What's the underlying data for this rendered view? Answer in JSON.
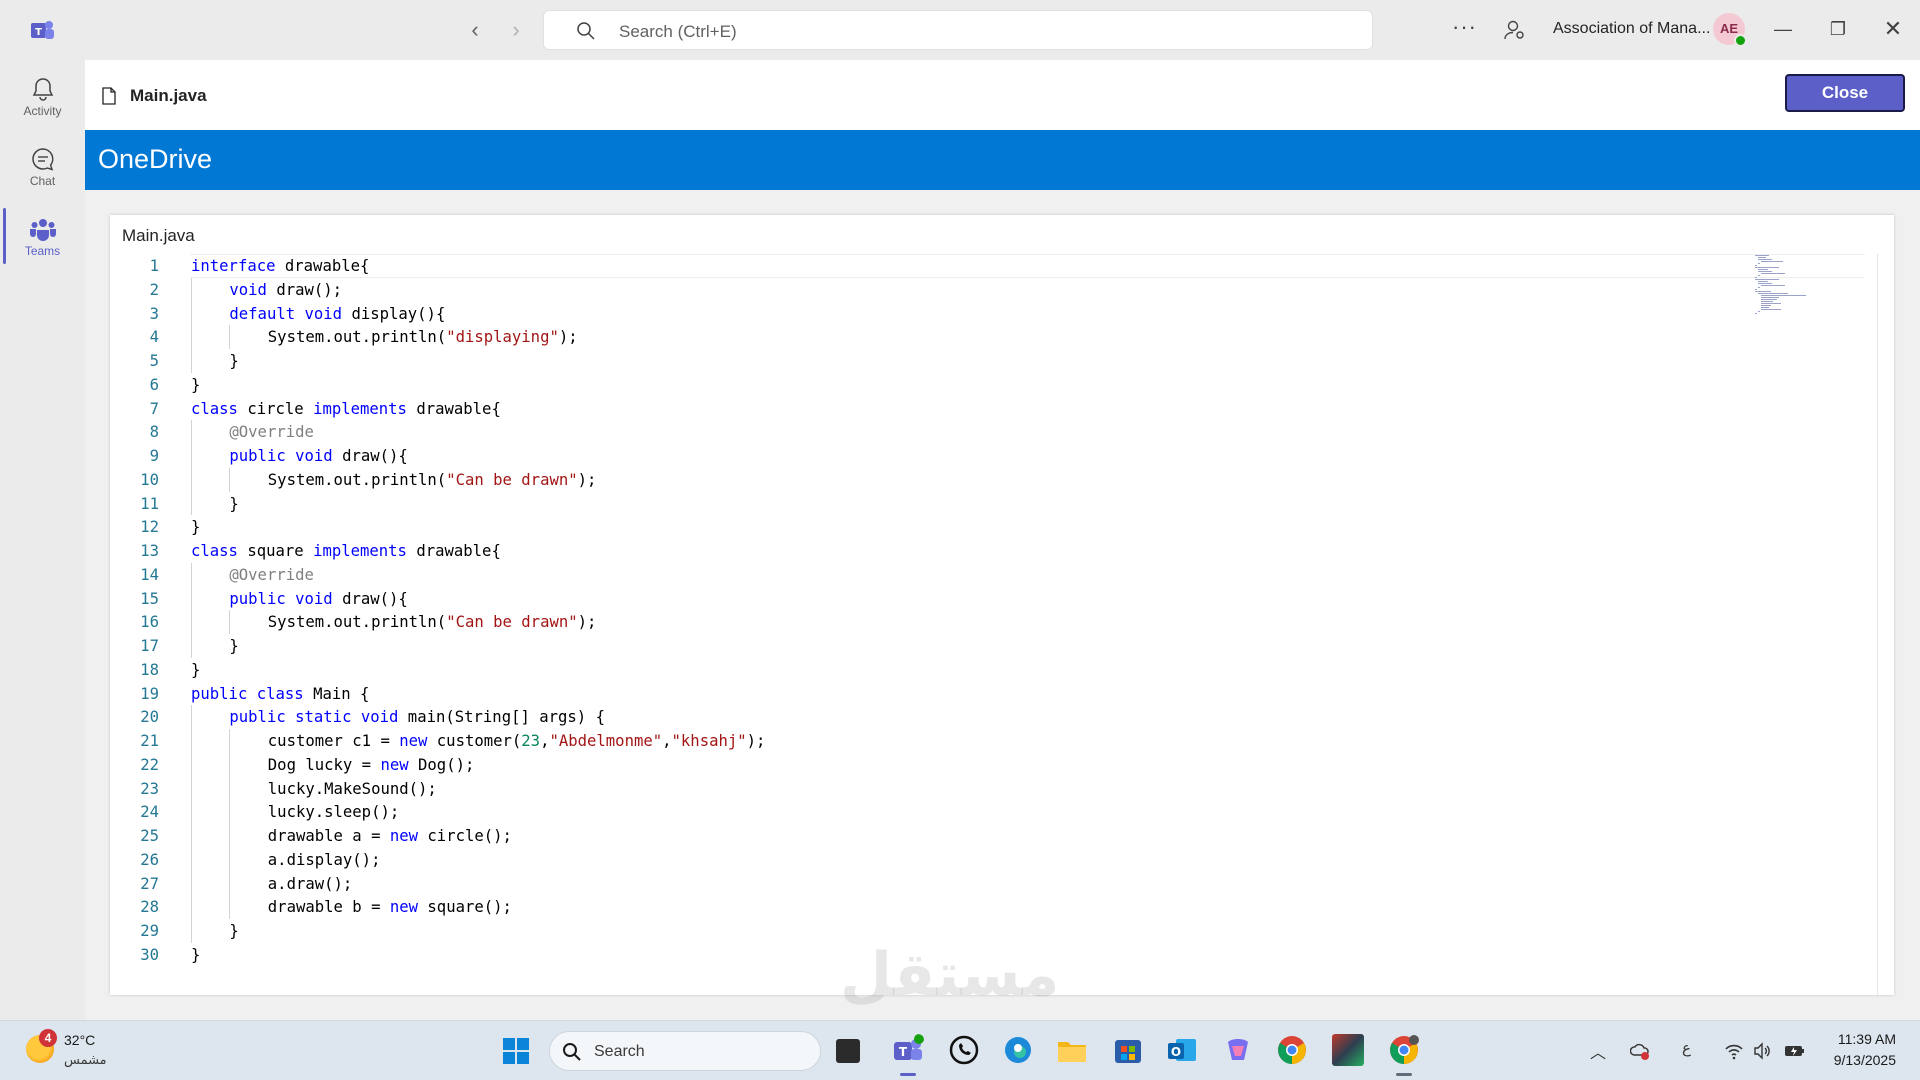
{
  "titlebar": {
    "search_placeholder": "Search (Ctrl+E)",
    "org_name": "Association of Mana...",
    "avatar_initials": "AE"
  },
  "rail": {
    "items": [
      {
        "label": "Activity",
        "icon": "bell-icon"
      },
      {
        "label": "Chat",
        "icon": "chat-icon"
      },
      {
        "label": "Teams",
        "icon": "teams-icon",
        "active": true
      }
    ]
  },
  "file_header": {
    "file_name": "Main.java",
    "close_label": "Close"
  },
  "banner": {
    "title": "OneDrive"
  },
  "viewer": {
    "title": "Main.java",
    "lines": [
      {
        "n": "1",
        "indent": 0,
        "tokens": [
          [
            "kw",
            "interface"
          ],
          [
            "t",
            " drawable{"
          ]
        ]
      },
      {
        "n": "2",
        "indent": 1,
        "tokens": [
          [
            "kw",
            "void"
          ],
          [
            "t",
            " draw();"
          ]
        ]
      },
      {
        "n": "3",
        "indent": 1,
        "tokens": [
          [
            "kw",
            "default"
          ],
          [
            "t",
            " "
          ],
          [
            "kw",
            "void"
          ],
          [
            "t",
            " display(){"
          ]
        ]
      },
      {
        "n": "4",
        "indent": 2,
        "tokens": [
          [
            "t",
            "System.out.println("
          ],
          [
            "str",
            "\"displaying\""
          ],
          [
            "t",
            ");"
          ]
        ]
      },
      {
        "n": "5",
        "indent": 1,
        "tokens": [
          [
            "t",
            "}"
          ]
        ]
      },
      {
        "n": "6",
        "indent": 0,
        "tokens": [
          [
            "t",
            "}"
          ]
        ]
      },
      {
        "n": "7",
        "indent": 0,
        "tokens": [
          [
            "kw",
            "class"
          ],
          [
            "t",
            " circle "
          ],
          [
            "kw",
            "implements"
          ],
          [
            "t",
            " drawable{"
          ]
        ]
      },
      {
        "n": "8",
        "indent": 1,
        "tokens": [
          [
            "ann",
            "@Override"
          ]
        ]
      },
      {
        "n": "9",
        "indent": 1,
        "tokens": [
          [
            "kw",
            "public"
          ],
          [
            "t",
            " "
          ],
          [
            "kw",
            "void"
          ],
          [
            "t",
            " draw(){"
          ]
        ]
      },
      {
        "n": "10",
        "indent": 2,
        "tokens": [
          [
            "t",
            "System.out.println("
          ],
          [
            "str",
            "\"Can be drawn\""
          ],
          [
            "t",
            ");"
          ]
        ]
      },
      {
        "n": "11",
        "indent": 1,
        "tokens": [
          [
            "t",
            "}"
          ]
        ]
      },
      {
        "n": "12",
        "indent": 0,
        "tokens": [
          [
            "t",
            "}"
          ]
        ]
      },
      {
        "n": "13",
        "indent": 0,
        "tokens": [
          [
            "kw",
            "class"
          ],
          [
            "t",
            " square "
          ],
          [
            "kw",
            "implements"
          ],
          [
            "t",
            " drawable{"
          ]
        ]
      },
      {
        "n": "14",
        "indent": 1,
        "tokens": [
          [
            "ann",
            "@Override"
          ]
        ]
      },
      {
        "n": "15",
        "indent": 1,
        "tokens": [
          [
            "kw",
            "public"
          ],
          [
            "t",
            " "
          ],
          [
            "kw",
            "void"
          ],
          [
            "t",
            " draw(){"
          ]
        ]
      },
      {
        "n": "16",
        "indent": 2,
        "tokens": [
          [
            "t",
            "System.out.println("
          ],
          [
            "str",
            "\"Can be drawn\""
          ],
          [
            "t",
            ");"
          ]
        ]
      },
      {
        "n": "17",
        "indent": 1,
        "tokens": [
          [
            "t",
            "}"
          ]
        ]
      },
      {
        "n": "18",
        "indent": 0,
        "tokens": [
          [
            "t",
            "}"
          ]
        ]
      },
      {
        "n": "19",
        "indent": 0,
        "tokens": [
          [
            "kw",
            "public"
          ],
          [
            "t",
            " "
          ],
          [
            "kw",
            "class"
          ],
          [
            "t",
            " Main {"
          ]
        ]
      },
      {
        "n": "20",
        "indent": 1,
        "tokens": [
          [
            "kw",
            "public"
          ],
          [
            "t",
            " "
          ],
          [
            "kw",
            "static"
          ],
          [
            "t",
            " "
          ],
          [
            "kw",
            "void"
          ],
          [
            "t",
            " main(String[] args) {"
          ]
        ]
      },
      {
        "n": "21",
        "indent": 2,
        "tokens": [
          [
            "t",
            "customer c1 = "
          ],
          [
            "kw",
            "new"
          ],
          [
            "t",
            " customer("
          ],
          [
            "num",
            "23"
          ],
          [
            "t",
            ","
          ],
          [
            "str",
            "\"Abdelmonme\""
          ],
          [
            "t",
            ","
          ],
          [
            "str",
            "\"khsahj\""
          ],
          [
            "t",
            ");"
          ]
        ]
      },
      {
        "n": "22",
        "indent": 2,
        "tokens": [
          [
            "t",
            "Dog lucky = "
          ],
          [
            "kw",
            "new"
          ],
          [
            "t",
            " Dog();"
          ]
        ]
      },
      {
        "n": "23",
        "indent": 2,
        "tokens": [
          [
            "t",
            "lucky.MakeSound();"
          ]
        ]
      },
      {
        "n": "24",
        "indent": 2,
        "tokens": [
          [
            "t",
            "lucky.sleep();"
          ]
        ]
      },
      {
        "n": "25",
        "indent": 2,
        "tokens": [
          [
            "t",
            "drawable a = "
          ],
          [
            "kw",
            "new"
          ],
          [
            "t",
            " circle();"
          ]
        ]
      },
      {
        "n": "26",
        "indent": 2,
        "tokens": [
          [
            "t",
            "a.display();"
          ]
        ]
      },
      {
        "n": "27",
        "indent": 2,
        "tokens": [
          [
            "t",
            "a.draw();"
          ]
        ]
      },
      {
        "n": "28",
        "indent": 2,
        "tokens": [
          [
            "t",
            "drawable b = "
          ],
          [
            "kw",
            "new"
          ],
          [
            "t",
            " square();"
          ]
        ]
      },
      {
        "n": "29",
        "indent": 1,
        "tokens": [
          [
            "t",
            "}"
          ]
        ]
      },
      {
        "n": "30",
        "indent": 0,
        "tokens": [
          [
            "t",
            "}"
          ]
        ]
      }
    ]
  },
  "taskbar": {
    "weather_temp": "32°C",
    "weather_desc": "مشمس",
    "weather_badge": "4",
    "search_label": "Search",
    "tray_lang": "ع",
    "time": "11:39 AM",
    "date": "9/13/2025",
    "apps": [
      "file-explorer-icon",
      "teams-icon",
      "whatsapp-icon",
      "edge-icon",
      "folder-icon",
      "store-icon",
      "outlook-icon",
      "copilot-icon",
      "chrome-icon",
      "game-icon",
      "chrome-profile-icon"
    ]
  },
  "colors": {
    "teams_purple": "#5b5fc7",
    "onedrive_blue": "#0078d4",
    "keyword_blue": "#0000ff",
    "string_red": "#a31515",
    "number_green": "#098658",
    "line_number": "#237893"
  },
  "watermark": "مستقل"
}
